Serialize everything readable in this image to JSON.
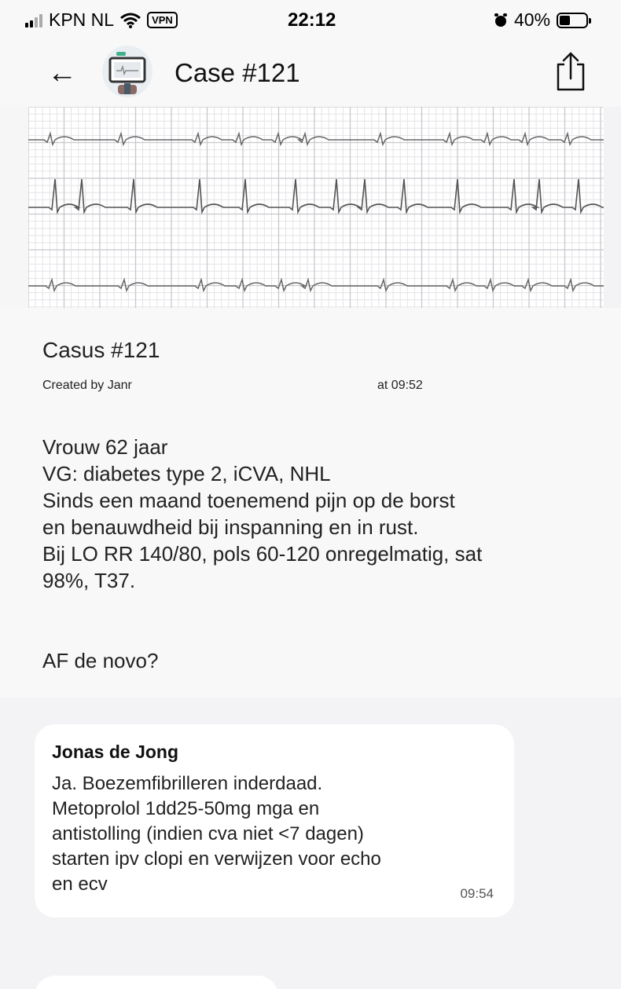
{
  "status_bar": {
    "carrier": "KPN NL",
    "vpn_label": "VPN",
    "time": "22:12",
    "battery_percent": "40%",
    "battery_level": 0.4,
    "icons": [
      "signal-icon",
      "wifi-icon",
      "alarm-icon",
      "battery-icon"
    ]
  },
  "header": {
    "title": "Case #121",
    "back_icon": "arrow-left-icon",
    "share_icon": "share-icon"
  },
  "case": {
    "title": "Casus #121",
    "created_by": "Created by Janr",
    "created_at": "at 09:52",
    "description_lines": [
      "Vrouw 62 jaar",
      "VG: diabetes type 2, iCVA, NHL",
      "Sinds een maand toenemend pijn op de borst",
      "en benauwdheid bij inspanning en in rust.",
      "Bij LO RR 140/80, pols 60-120 onregelmatig, sat",
      "98%, T37."
    ],
    "question": "AF de novo?"
  },
  "comments": [
    {
      "author": "Jonas de Jong",
      "text_lines": [
        "Ja. Boezemfibrilleren inderdaad.",
        "Metoprolol 1dd25-50mg mga en",
        "antistolling (indien cva niet <7 dagen)",
        "starten ipv clopi en verwijzen voor echo",
        "en ecv"
      ],
      "time": "09:54"
    }
  ],
  "colors": {
    "background": "#f3f3f5",
    "card": "#ffffff",
    "text": "#222222",
    "ecg_grid": "#d0d0d4",
    "ecg_trace": "#555555"
  }
}
